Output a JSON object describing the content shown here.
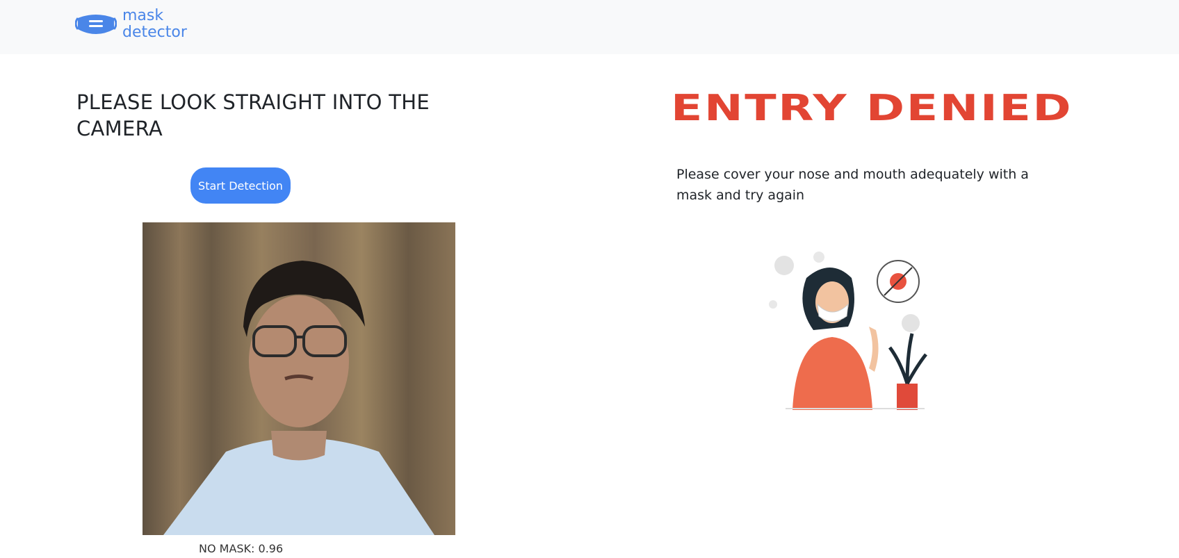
{
  "navbar": {
    "brand_line1": "mask",
    "brand_line2": "detector",
    "logo_icon": "mask-icon",
    "accent_color": "#4a86e8"
  },
  "detection": {
    "instruction": "PLEASE LOOK STRAIGHT INTO THE CAMERA",
    "start_button": "Start Detection",
    "result_label": "NO MASK: 0.96"
  },
  "result": {
    "title": "ENTRY DENIED",
    "message": "Please cover your nose and mouth adequately with a mask and try again",
    "title_color": "#e24533",
    "illustration_icon": "masked-woman-illustration"
  }
}
